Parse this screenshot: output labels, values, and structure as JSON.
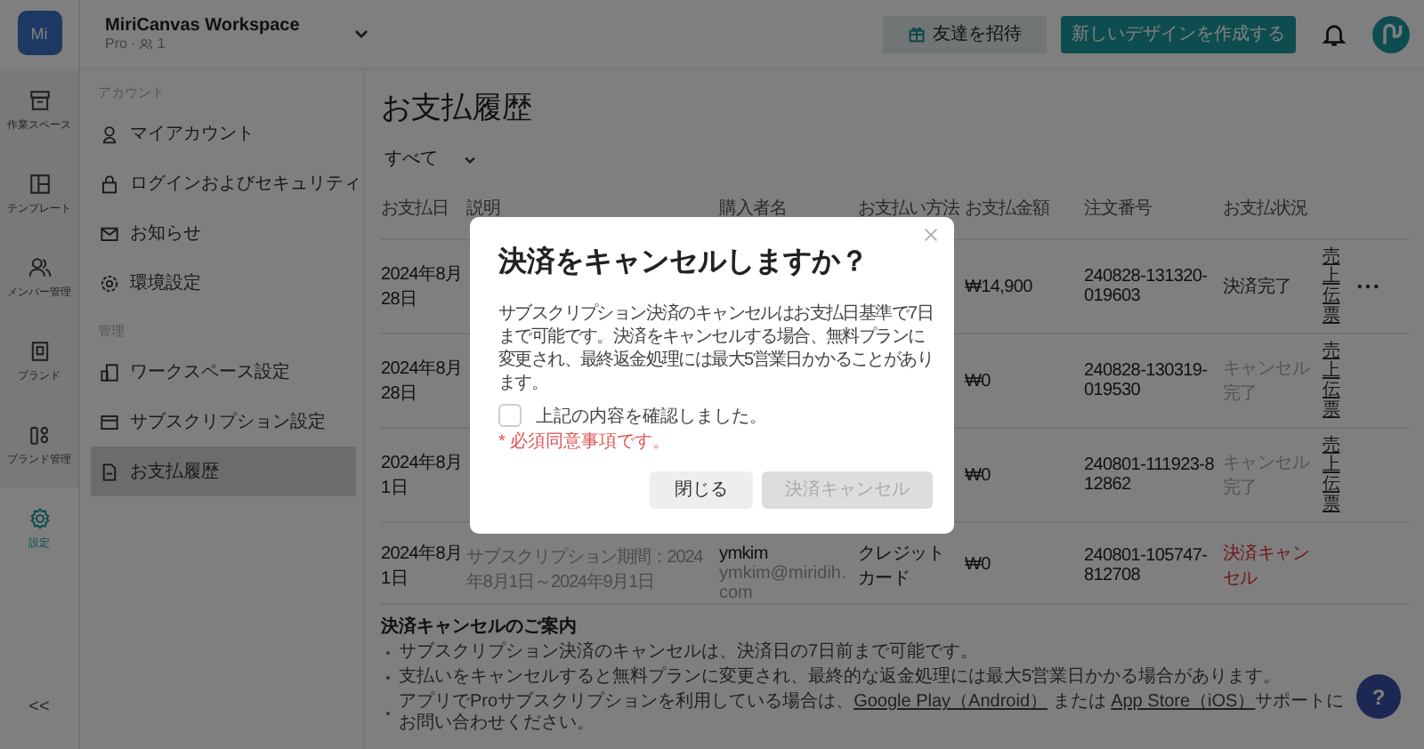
{
  "rail": {
    "logo": "Mi",
    "items": [
      {
        "label": "作業スペース",
        "selected": false
      },
      {
        "label": "テンプレート",
        "selected": false
      },
      {
        "label": "メンバー管理",
        "selected": false
      },
      {
        "label": "ブランド",
        "selected": false
      },
      {
        "label": "ブランド管理",
        "selected": false
      },
      {
        "label": "設定",
        "selected": true
      }
    ],
    "collapse": "<<"
  },
  "topbar": {
    "workspace": "MiriCanvas Workspace",
    "plan": "Pro ·",
    "members": "1",
    "invite": "友達を招待",
    "create": "新しいデザインを作成する"
  },
  "sidebar": {
    "sections": [
      {
        "heading": "アカウント",
        "items": [
          {
            "label": "マイアカウント",
            "selected": false
          },
          {
            "label": "ログインおよびセキュリティ",
            "selected": false
          },
          {
            "label": "お知らせ",
            "selected": false
          },
          {
            "label": "環境設定",
            "selected": false
          }
        ]
      },
      {
        "heading": "管理",
        "items": [
          {
            "label": "ワークスペース設定",
            "selected": false
          },
          {
            "label": "サブスクリプション設定",
            "selected": false
          },
          {
            "label": "お支払履歴",
            "selected": true
          }
        ]
      }
    ]
  },
  "page": {
    "title": "お支払履歴",
    "filter": "すべて"
  },
  "table": {
    "columns": [
      "お支払日",
      "説明",
      "購入者名",
      "お支払い方法",
      "お支払金額",
      "注文番号",
      "お支払状況"
    ],
    "rows": [
      {
        "date": "2024年8月28日",
        "amount": "₩14,900",
        "order": "240828-131320-019603",
        "status": "決済完了",
        "kind": "done",
        "receipt": "売上伝票",
        "menu": true
      },
      {
        "date": "2024年8月28日",
        "amount": "₩0",
        "order": "240828-130319-019530",
        "status": "キャンセル完了",
        "kind": "cancelled",
        "receipt": "売上伝票",
        "menu": false
      },
      {
        "date": "2024年8月1日",
        "amount": "₩0",
        "order": "240801-111923-812862",
        "status": "キャンセル完了",
        "kind": "cancelled",
        "receipt": "売上伝票",
        "menu": false
      },
      {
        "date": "2024年8月1日",
        "period": "サブスクリプション期間：2024年8月1日～2024年9月1日",
        "buyer": "ymkim",
        "email": "ymkim@miridih.com",
        "method": "クレジットカード",
        "amount": "₩0",
        "order": "240801-105747-812708",
        "status": "決済キャンセル",
        "kind": "failed",
        "menu": false
      }
    ]
  },
  "help": "?",
  "notice": {
    "title": "決済キャンセルのご案内",
    "items": [
      [
        {
          "text": "サブスクリプション決済のキャンセルは、決済日の7日前まで可能です。"
        }
      ],
      [
        {
          "text": "支払いをキャンセルすると無料プランに変更され、最終的な返金処理には最大5営業日かかる場合があります。"
        }
      ],
      [
        {
          "text": "アプリでProサブスクリプションを利用している場合は、"
        },
        {
          "link": "Google Play（Android）"
        },
        {
          "text": " または "
        },
        {
          "link": "App Store（iOS）"
        },
        {
          "text": "サポートにお問い合わせください。"
        }
      ]
    ]
  },
  "modal": {
    "title": "決済をキャンセルしますか？",
    "body": "サブスクリプション決済のキャンセルはお支払日基準で7日まで可能です。決済をキャンセルする場合、無料プランに変更され、最終返金処理には最大5営業日かかることがあります。",
    "checkbox": {
      "label": "上記の内容を確認しました。",
      "checked": false
    },
    "error": "* 必須同意事項です。",
    "buttons": [
      {
        "label": "閉じる",
        "disabled": false
      },
      {
        "label": "決済キャンセル",
        "disabled": true
      }
    ]
  }
}
